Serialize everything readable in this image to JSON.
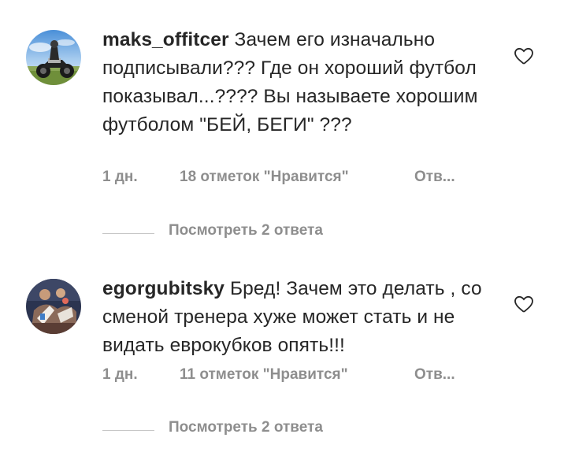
{
  "comments": [
    {
      "username": "maks_offitcer",
      "text": "Зачем его изначально подписывали??? Где он хороший футбол показывал...???? Вы называете хорошим футболом \"БЕЙ, БЕГИ\" ???",
      "time": "1 дн.",
      "likes": "18 отметок \"Нравится\"",
      "reply": "Отв...",
      "view_replies": "Посмотреть 2 ответа",
      "avatar_icon": "motorcycle-avatar"
    },
    {
      "username": "egorgubitsky",
      "text": "Бред! Зачем это делать , со сменой тренера хуже может стать и не видать еврокубков опять!!!",
      "time": "1 дн.",
      "likes": "11 отметок \"Нравится\"",
      "reply": "Отв...",
      "view_replies": "Посмотреть 2 ответа",
      "avatar_icon": "people-avatar"
    }
  ],
  "icons": {
    "like": "heart-outline-icon"
  },
  "colors": {
    "text": "#262626",
    "meta": "#8e8e8e",
    "divider": "#c7c7c7"
  }
}
